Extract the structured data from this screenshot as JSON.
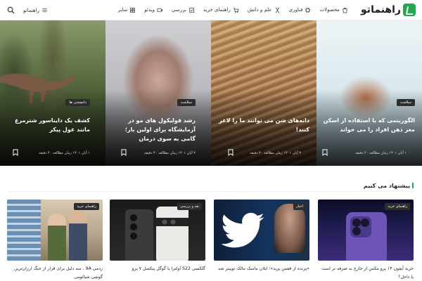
{
  "header": {
    "logo_text": "راهنماتو",
    "nav": [
      {
        "label": "محصولات",
        "icon": "shopping-bag-icon"
      },
      {
        "label": "فناوری",
        "icon": "chip-icon"
      },
      {
        "label": "علم و دانش",
        "icon": "dna-icon"
      },
      {
        "label": "راهنمای خرید",
        "icon": "cart-icon"
      },
      {
        "label": "بررسی",
        "icon": "review-icon"
      },
      {
        "label": "ویدئو",
        "icon": "video-icon"
      },
      {
        "label": "سایر",
        "icon": "grid-icon"
      }
    ],
    "hamburger_label": "راهنماتو",
    "search_icon": "search-icon"
  },
  "hero": [
    {
      "badge": "سلامت",
      "title": "الگوریتمی که با استفاده از اسکن مغز ذهن افراد را می خواند",
      "meta": "۱ آبان ۱۴۰۱  زمان مطالعه ۴۰ دقیقه"
    },
    {
      "badge": "",
      "title": "دانه‌های شن می توانند ما را لاغر کنند!",
      "meta": "۳ آبان ۱۴۰۱  زمان مطالعه ۴۰ دقیقه"
    },
    {
      "badge": "سلامت",
      "title": "رشد فولیکول های مو در آزمایشگاه برای اولین بار؛ گامی به سوی درمان",
      "meta": "۲ آبان ۱۴۰۱  زمان مطالعه ۴۰ دقیقه"
    },
    {
      "badge": "دانستنی ها",
      "title": "کشف یک دایناسور شترمرغ مانند غول پیکر",
      "meta": "۱ آبان ۱۴۰۱  زمان مطالعه ۴۰ دقیقه"
    }
  ],
  "section": {
    "title": "پیشنهاد می کنیم"
  },
  "cards": [
    {
      "badge": "راهنمای خرید",
      "title": "خرید آیفون ۱۴ پرو مکس از خارج به صرفه تر است یا داخل؟"
    },
    {
      "badge": "اخبار",
      "title": "«پرنده از قفس پرید»؛ ایلان ماسک مالک توییتر شد"
    },
    {
      "badge": "نقد و بررسی",
      "title": "گلکسی S22 اولترا یا گوگل پیکسل ۷ پرو"
    },
    {
      "badge": "راهنمای خرید",
      "title": "ردمی 9A ، سه دلیل برای قرار از جنگ ارزان‌ترین گوشی شیائومی"
    }
  ],
  "colors": {
    "accent": "#22a64f",
    "badge_bg": "#2d2d2d"
  }
}
